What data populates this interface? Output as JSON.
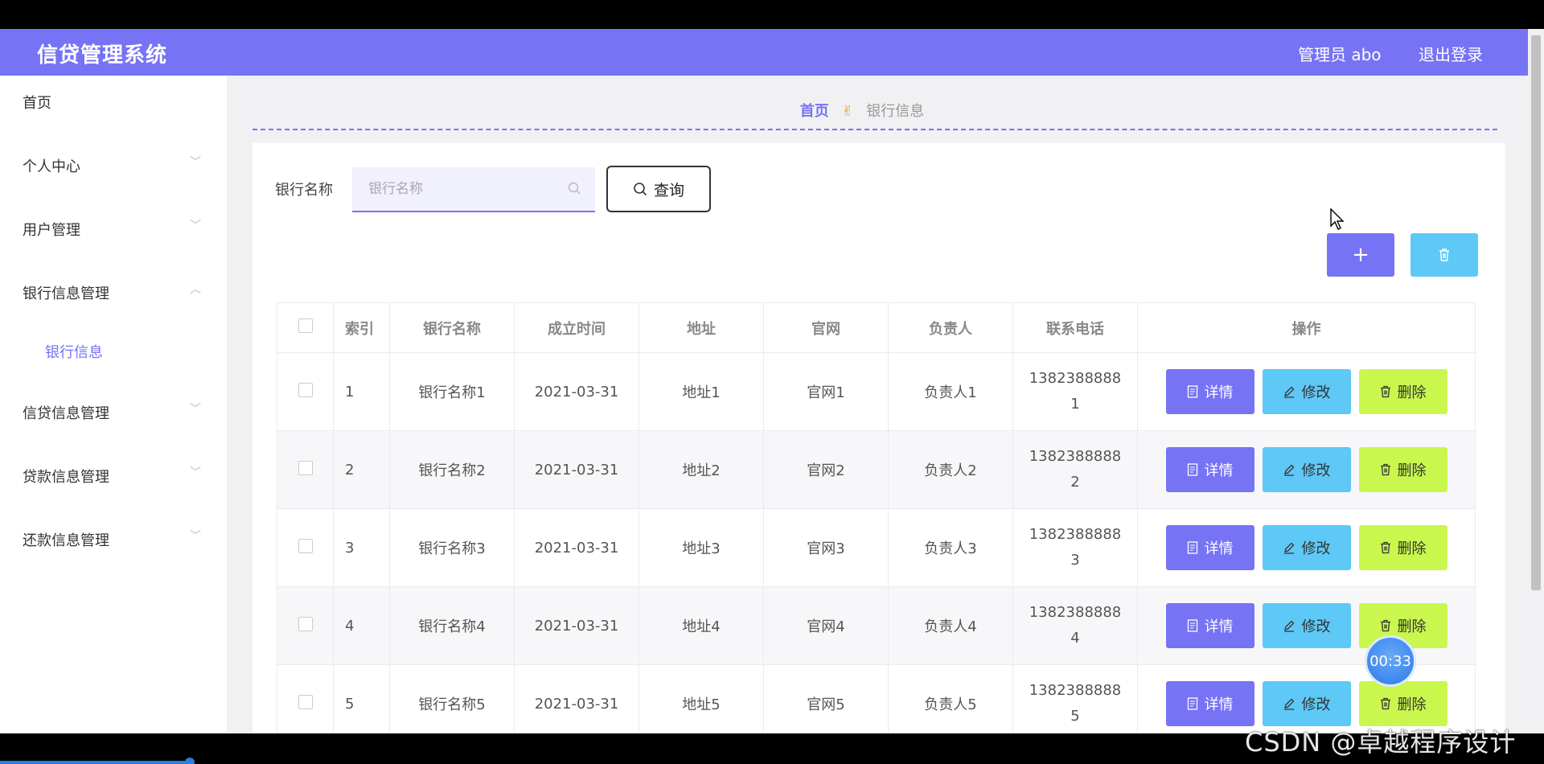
{
  "header": {
    "title": "信贷管理系统",
    "admin_label": "管理员 abo",
    "logout_label": "退出登录"
  },
  "sidebar": {
    "items": [
      {
        "label": "首页",
        "has_chevron": false
      },
      {
        "label": "个人中心",
        "has_chevron": true,
        "chevron": "﹀"
      },
      {
        "label": "用户管理",
        "has_chevron": true,
        "chevron": "﹀"
      },
      {
        "label": "银行信息管理",
        "has_chevron": true,
        "chevron": "︿"
      },
      {
        "label": "银行信息",
        "sub": true
      },
      {
        "label": "信贷信息管理",
        "has_chevron": true,
        "chevron": "﹀"
      },
      {
        "label": "贷款信息管理",
        "has_chevron": true,
        "chevron": "﹀"
      },
      {
        "label": "还款信息管理",
        "has_chevron": true,
        "chevron": "﹀"
      }
    ]
  },
  "breadcrumb": {
    "home": "首页",
    "separator_icon": "hand-icon",
    "current": "银行信息"
  },
  "search": {
    "label": "银行名称",
    "placeholder": "银行名称",
    "value": "",
    "button_label": "查询"
  },
  "actions": {
    "add_icon": "+",
    "delete_icon": "trash-icon"
  },
  "table": {
    "headers": [
      "索引",
      "银行名称",
      "成立时间",
      "地址",
      "官网",
      "负责人",
      "联系电话",
      "操作"
    ],
    "rows": [
      {
        "index": "1",
        "name": "银行名称1",
        "date": "2021-03-31",
        "address": "地址1",
        "site": "官网1",
        "person": "负责人1",
        "phone_a": "1382388888",
        "phone_b": "1"
      },
      {
        "index": "2",
        "name": "银行名称2",
        "date": "2021-03-31",
        "address": "地址2",
        "site": "官网2",
        "person": "负责人2",
        "phone_a": "1382388888",
        "phone_b": "2"
      },
      {
        "index": "3",
        "name": "银行名称3",
        "date": "2021-03-31",
        "address": "地址3",
        "site": "官网3",
        "person": "负责人3",
        "phone_a": "1382388888",
        "phone_b": "3"
      },
      {
        "index": "4",
        "name": "银行名称4",
        "date": "2021-03-31",
        "address": "地址4",
        "site": "官网4",
        "person": "负责人4",
        "phone_a": "1382388888",
        "phone_b": "4"
      },
      {
        "index": "5",
        "name": "银行名称5",
        "date": "2021-03-31",
        "address": "地址5",
        "site": "官网5",
        "person": "负责人5",
        "phone_a": "1382388888",
        "phone_b": "5"
      }
    ],
    "ops": {
      "detail": "详情",
      "edit": "修改",
      "delete": "删除"
    }
  },
  "overlay": {
    "timer": "00:33",
    "watermark": "CSDN @卓越程序设计"
  },
  "colors": {
    "primary": "#7673f5",
    "info": "#5ec8f6",
    "danger": "#c9f74e"
  }
}
